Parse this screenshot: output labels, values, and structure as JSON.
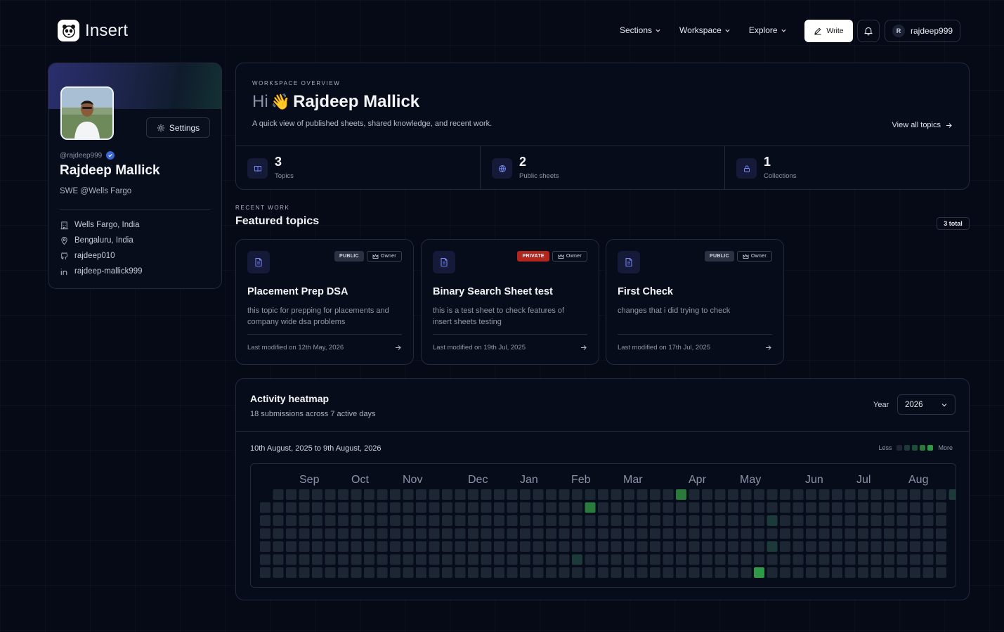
{
  "header": {
    "brand": "Insert",
    "nav": [
      "Sections",
      "Workspace",
      "Explore"
    ],
    "write_label": "Write",
    "user_initial": "R",
    "username": "rajdeep999"
  },
  "profile": {
    "settings_label": "Settings",
    "handle": "@rajdeep999",
    "name": "Rajdeep Mallick",
    "role": "SWE @Wells Fargo",
    "meta": [
      {
        "icon": "building-icon",
        "text": "Wells Fargo, India"
      },
      {
        "icon": "location-pin-icon",
        "text": "Bengaluru, India"
      },
      {
        "icon": "github-icon",
        "text": "rajdeep010"
      },
      {
        "icon": "linkedin-icon",
        "text": "rajdeep-mallick999"
      }
    ]
  },
  "overview": {
    "eyebrow": "WORKSPACE OVERVIEW",
    "hi": "Hi",
    "wave": "👋",
    "name": "Rajdeep Mallick",
    "subtitle": "A quick view of published sheets, shared knowledge, and recent work.",
    "view_all": "View all topics",
    "stats": [
      {
        "icon": "book-icon",
        "value": "3",
        "label": "Topics"
      },
      {
        "icon": "globe-icon",
        "value": "2",
        "label": "Public sheets"
      },
      {
        "icon": "lock-icon",
        "value": "1",
        "label": "Collections"
      }
    ]
  },
  "recent": {
    "eyebrow": "RECENT WORK",
    "title": "Featured topics",
    "total": "3 total",
    "owner_label": "Owner",
    "topics": [
      {
        "visibility": "PUBLIC",
        "title": "Placement Prep DSA",
        "desc": "this topic for prepping for placements and company wide dsa problems",
        "modified": "Last modified on 12th May, 2026"
      },
      {
        "visibility": "PRIVATE",
        "title": "Binary Search Sheet test",
        "desc": "this is a test sheet to check features of insert sheets testing",
        "modified": "Last modified on 19th Jul, 2025"
      },
      {
        "visibility": "PUBLIC",
        "title": "First Check",
        "desc": "changes that i did trying to check",
        "modified": "Last modified on 17th Jul, 2025"
      }
    ]
  },
  "heatmap": {
    "title": "Activity heatmap",
    "subtitle": "18 submissions across 7 active days",
    "year_label": "Year",
    "year": "2026",
    "range": "10th August, 2025 to 9th August, 2026",
    "legend_less": "Less",
    "legend_more": "More",
    "months": [
      "Sep",
      "Oct",
      "Nov",
      "Dec",
      "Jan",
      "Feb",
      "Mar",
      "Apr",
      "May",
      "Jun",
      "Jul",
      "Aug"
    ],
    "colors": {
      "empty": "#1c2634",
      "l1": "#1c3a3a",
      "l2": "#1f4d3b",
      "l3": "#2a7a3c",
      "l4": "#2f9a45"
    }
  }
}
